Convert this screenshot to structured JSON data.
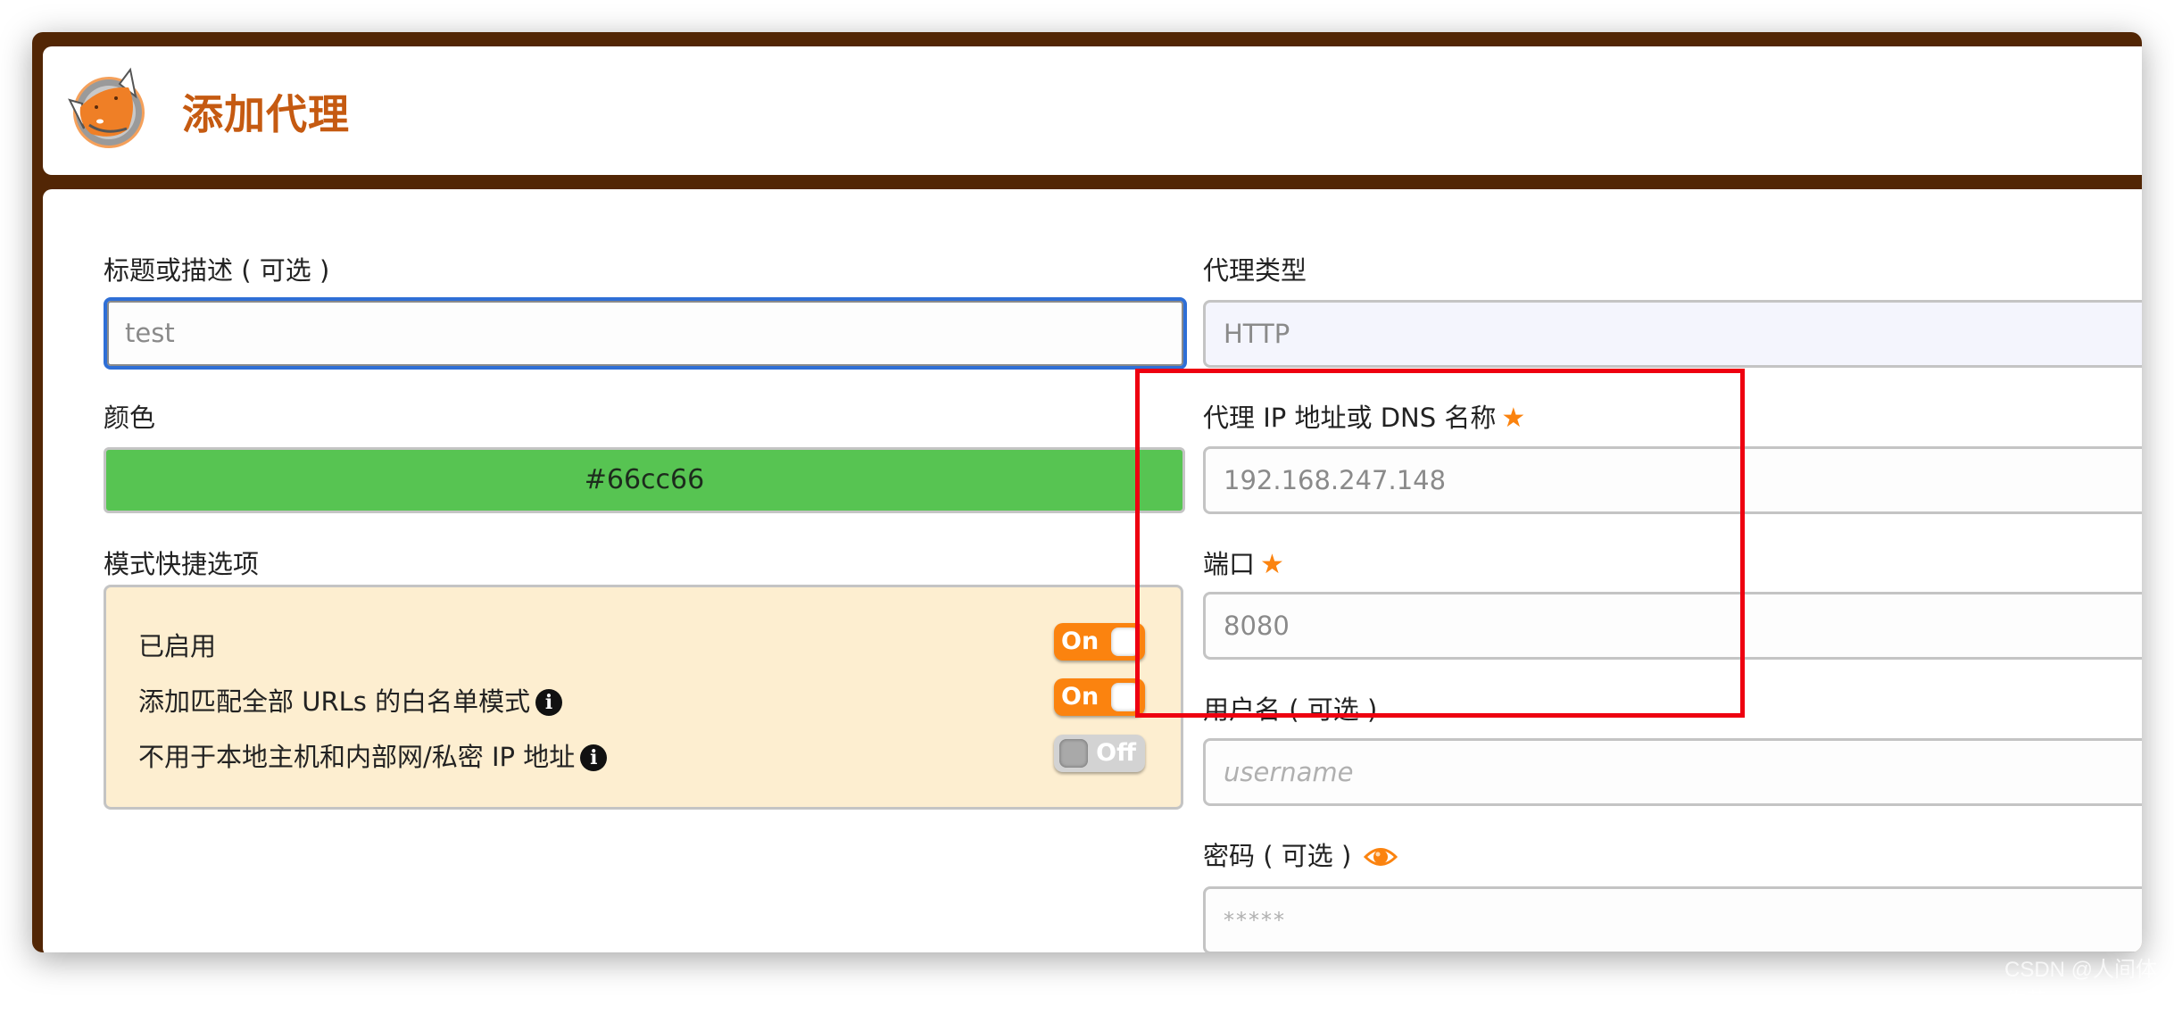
{
  "header": {
    "title": "添加代理",
    "logo": "foxyproxy-fox-logo"
  },
  "left": {
    "title_label": "标题或描述 ( 可选 )",
    "title_value": "test",
    "color_label": "颜色",
    "color_value": "#66cc66",
    "color_swatch": "#57c452",
    "pattern_label": "模式快捷选项",
    "options": [
      {
        "label": "已启用",
        "info": false,
        "state": "On",
        "on": true
      },
      {
        "label": "添加匹配全部 URLs 的白名单模式",
        "info": true,
        "state": "On",
        "on": true
      },
      {
        "label": "不用于本地主机和内部网/私密 IP 地址",
        "info": true,
        "state": "Off",
        "on": false
      }
    ]
  },
  "right": {
    "type_label": "代理类型",
    "type_value": "HTTP",
    "host_label": "代理 IP 地址或 DNS 名称",
    "host_value": "192.168.247.148",
    "port_label": "端口",
    "port_value": "8080",
    "username_label": "用户名 ( 可选 )",
    "username_placeholder": "username",
    "password_label": "密码 ( 可选 )",
    "password_placeholder": "*****"
  },
  "icons": {
    "required": "★",
    "info": "i"
  },
  "colors": {
    "frame": "#522605",
    "accent": "#fb830f",
    "title": "#c55a11",
    "focus": "#2f6fd6",
    "annotation": "#ee0010",
    "button_red": "#e0402f",
    "button_orange": "#fb830f",
    "button_blue": "#356ea8"
  },
  "watermark": "CSDN @人间体佐菲"
}
